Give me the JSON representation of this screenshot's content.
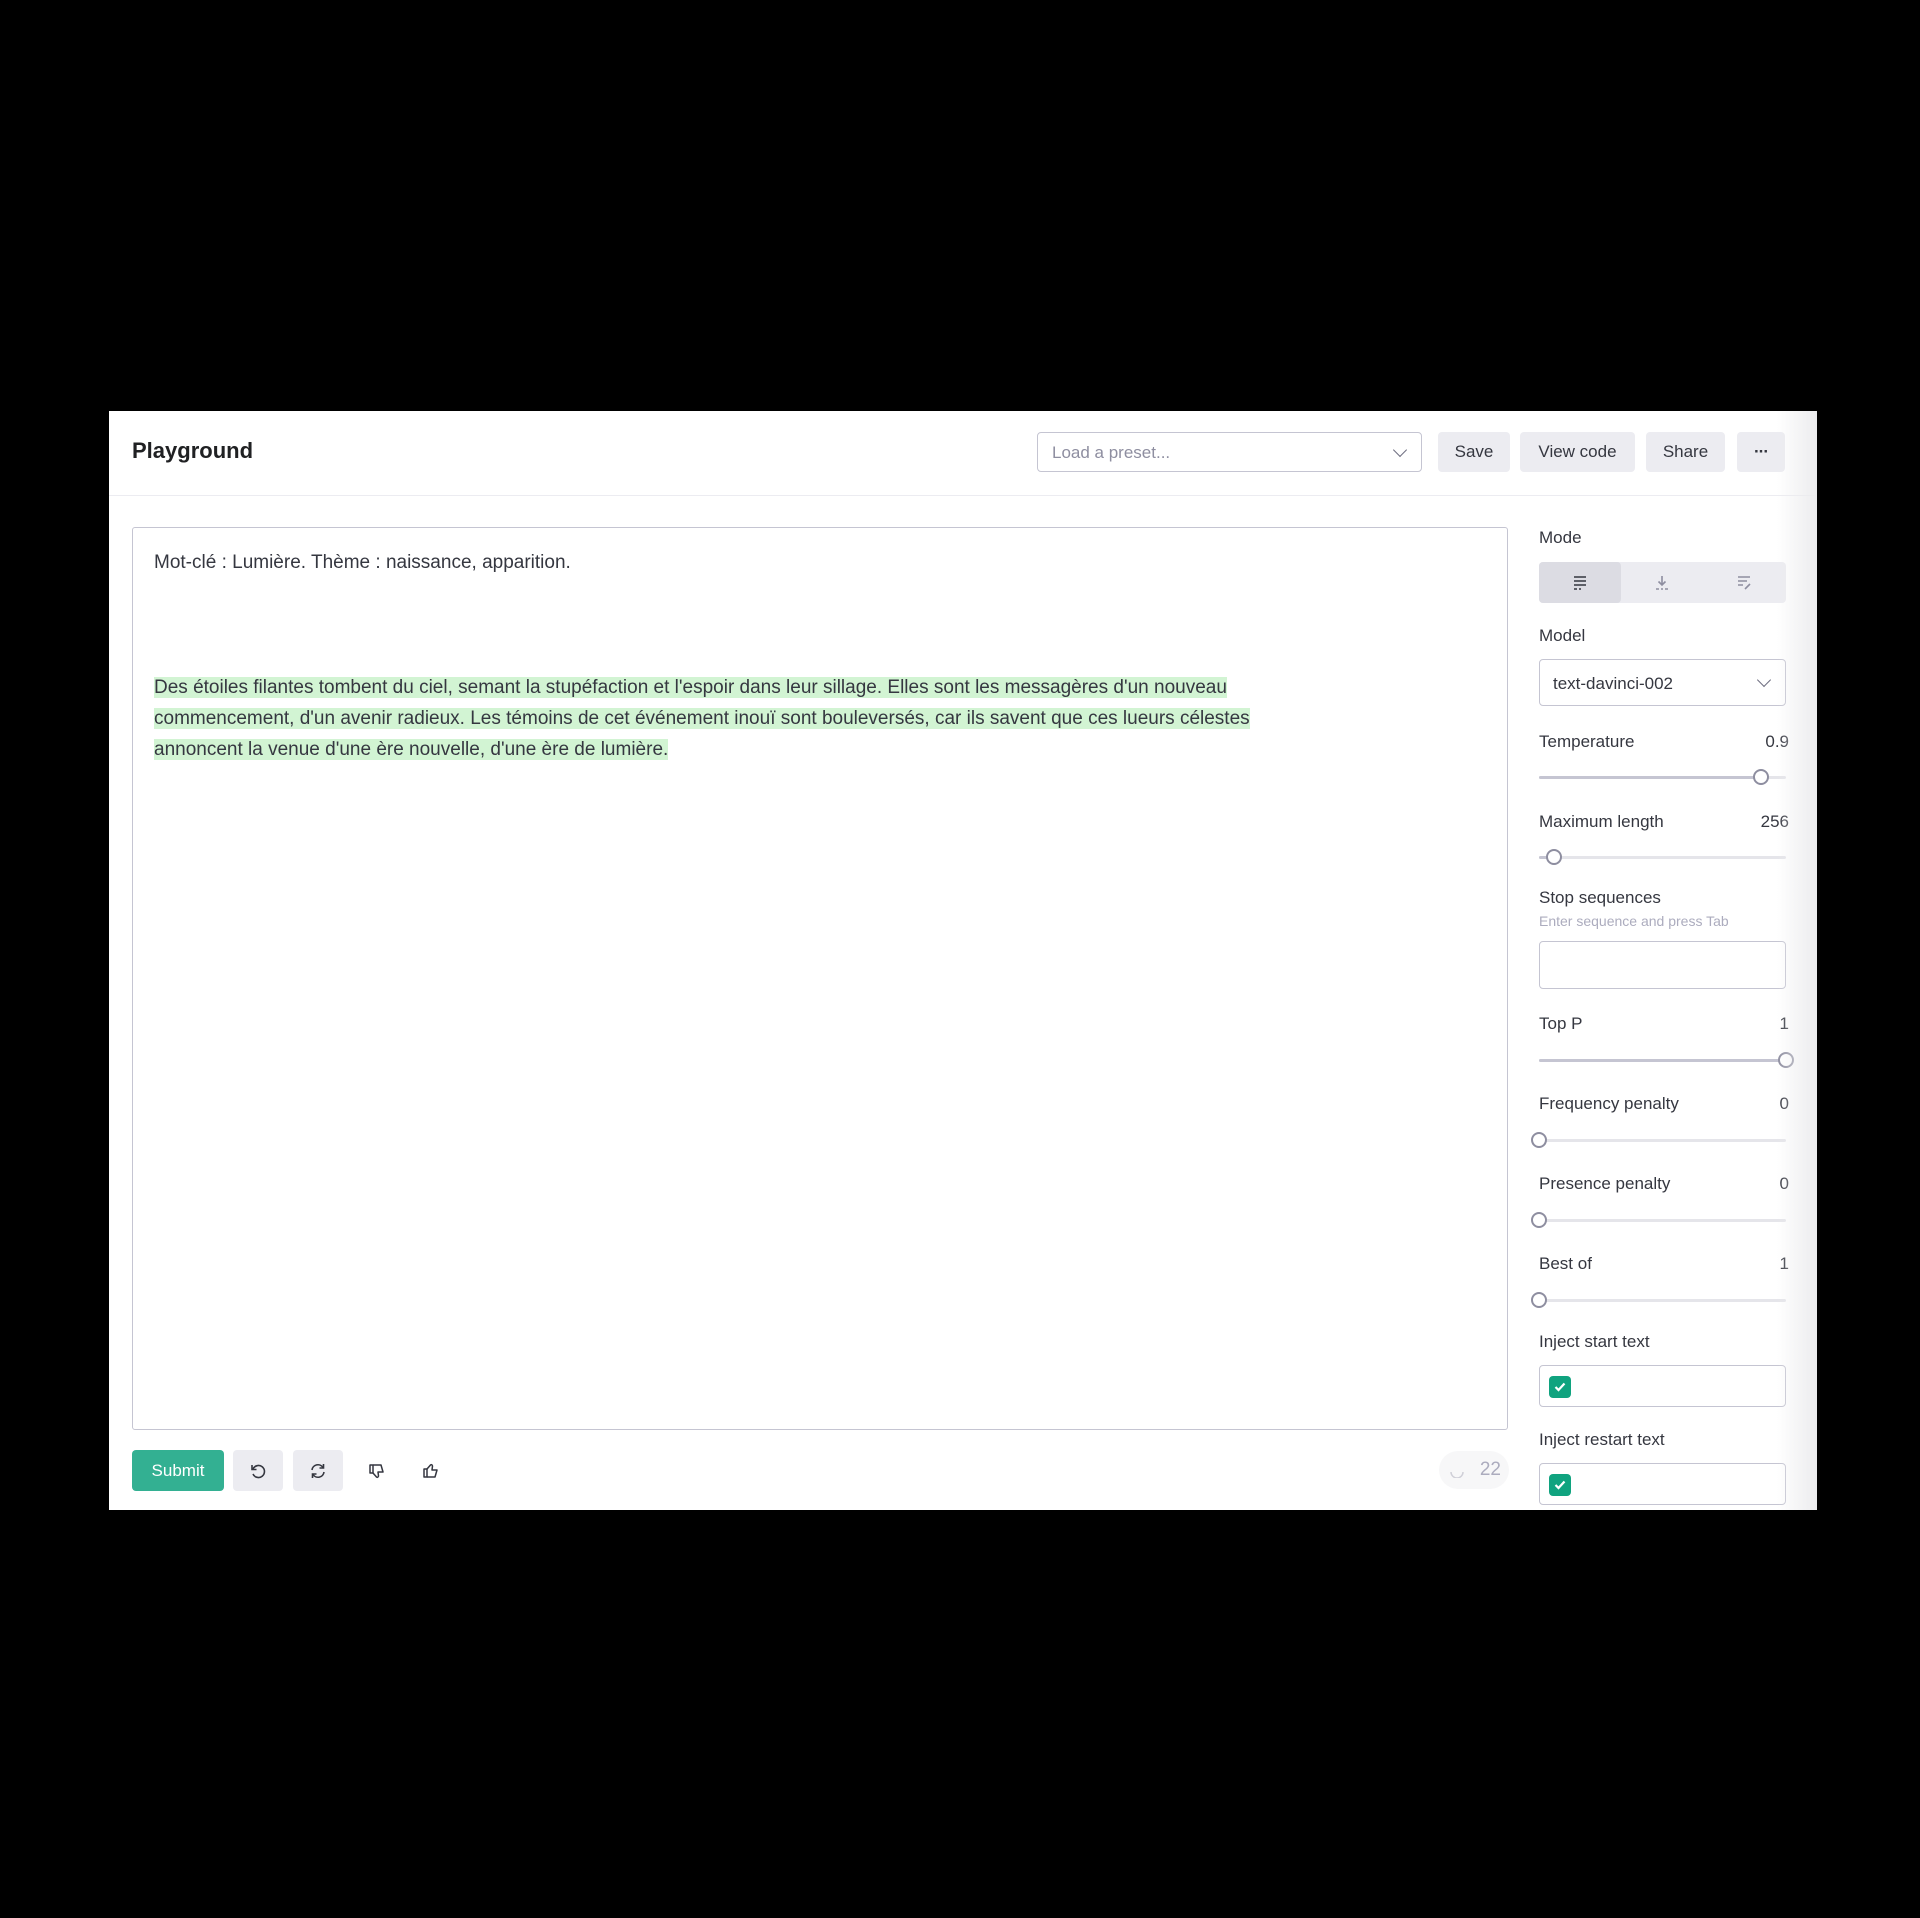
{
  "header": {
    "title": "Playground",
    "preset_placeholder": "Load a preset...",
    "save_label": "Save",
    "view_code_label": "View code",
    "share_label": "Share",
    "more_label": "···"
  },
  "editor": {
    "prompt": "Mot-clé : Lumière. Thème :  naissance, apparition.",
    "completion_lines": [
      "Des étoiles filantes tombent du ciel, semant la stupéfaction et l'espoir dans leur sillage. Elles sont les messagères d'un nouveau",
      "commencement, d'un avenir radieux. Les témoins de cet événement inouï sont bouleversés, car ils savent que ces lueurs célestes",
      "annoncent la venue d'une ère nouvelle, d'une ère de lumière."
    ],
    "highlight_color": "#d2f4d3"
  },
  "footer": {
    "submit_label": "Submit",
    "token_count": "22"
  },
  "settings": {
    "mode_label": "Mode",
    "mode_options": [
      "complete-icon",
      "insert-icon",
      "edit-icon"
    ],
    "mode_selected": 0,
    "model_label": "Model",
    "model_value": "text-davinci-002",
    "temperature": {
      "label": "Temperature",
      "value": "0.9",
      "fraction": 0.9
    },
    "max_length": {
      "label": "Maximum length",
      "value": "256",
      "fraction": 0.06
    },
    "stop_sequences": {
      "label": "Stop sequences",
      "hint": "Enter sequence and press Tab"
    },
    "top_p": {
      "label": "Top P",
      "value": "1",
      "fraction": 1.0
    },
    "frequency_penalty": {
      "label": "Frequency penalty",
      "value": "0",
      "fraction": 0.0
    },
    "presence_penalty": {
      "label": "Presence penalty",
      "value": "0",
      "fraction": 0.0
    },
    "best_of": {
      "label": "Best of",
      "value": "1",
      "fraction": 0.0
    },
    "inject_start": {
      "label": "Inject start text",
      "checked": true
    },
    "inject_restart": {
      "label": "Inject restart text",
      "checked": true
    }
  },
  "colors": {
    "accent": "#10a37f",
    "background": "#000000"
  }
}
